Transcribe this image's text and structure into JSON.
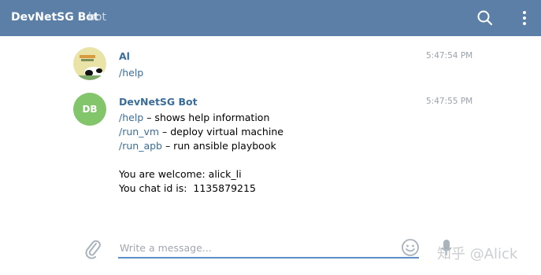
{
  "header": {
    "title": "DevNetSG Bot",
    "subtitle": "bot",
    "search_icon": "search-icon",
    "menu_icon": "more-vertical-icon"
  },
  "messages": [
    {
      "author": "Al",
      "avatar_icon": "panda-image",
      "time": "5:47:54 PM",
      "lines": [
        "/help"
      ]
    },
    {
      "author": "DevNetSG Bot",
      "avatar_initials": "DB",
      "avatar_color": "#83c56a",
      "time": "5:47:55 PM",
      "commands": [
        {
          "cmd": "/help",
          "desc": " – shows help information"
        },
        {
          "cmd": "/run_vm",
          "desc": " – deploy virtual machine"
        },
        {
          "cmd": "/run_apb",
          "desc": " – run ansible playbook"
        }
      ],
      "welcome": "You are welcome: alick_li",
      "chat_id": "You chat id is:  1135879215"
    }
  ],
  "composer": {
    "placeholder": "Write a message...",
    "attach_icon": "paperclip-icon",
    "emoji_icon": "smiley-icon",
    "mic_icon": "microphone-icon"
  },
  "watermark": "知乎 @Alick",
  "colors": {
    "header_bg": "#5b7fa6",
    "link": "#3a6d99",
    "accent": "#5b8fc5"
  }
}
